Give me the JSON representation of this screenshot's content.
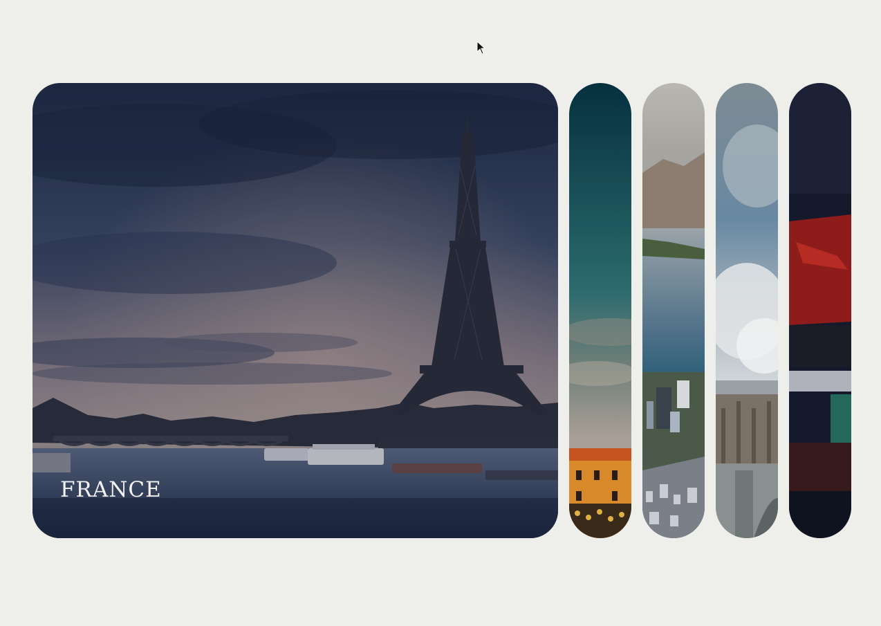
{
  "gallery": {
    "active_index": 0,
    "panels": [
      {
        "label": "FRANCE",
        "icon": "eiffel-tower-image"
      },
      {
        "label": "",
        "icon": "sky-street-image"
      },
      {
        "label": "",
        "icon": "coastal-city-image"
      },
      {
        "label": "",
        "icon": "bridge-clouds-image"
      },
      {
        "label": "",
        "icon": "red-neon-image"
      }
    ]
  },
  "cursor": {
    "icon": "mouse-pointer-icon"
  },
  "colors": {
    "background": "#eeeeea",
    "caption": "#f2f2f2"
  }
}
